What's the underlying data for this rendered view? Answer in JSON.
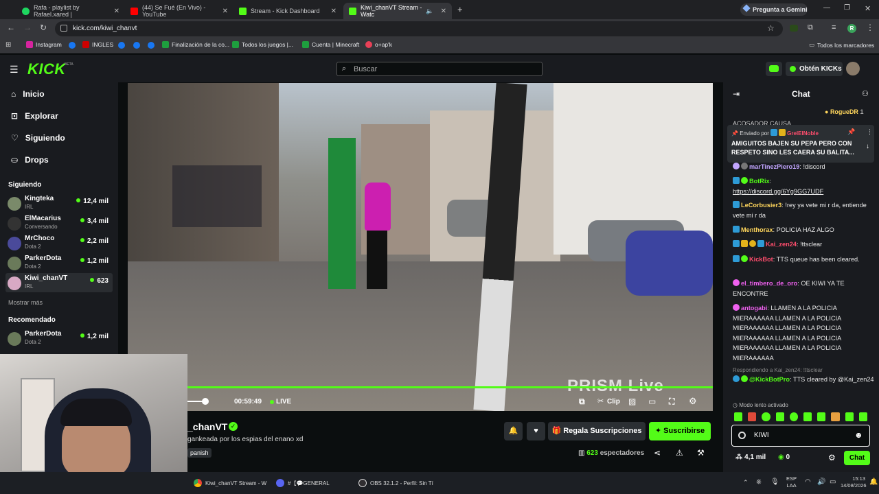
{
  "browser": {
    "tabs": [
      {
        "title": "Rafa - playlist by Rafael.xared |",
        "color": "#1ed760"
      },
      {
        "title": "(44) Se Fué (En Vivo) - YouTube",
        "color": "#ff0000"
      },
      {
        "title": "Stream - Kick Dashboard",
        "color": "#53fc18"
      },
      {
        "title": "Kiwi_chanVT Stream - Watc",
        "color": "#53fc18"
      }
    ],
    "gemini_label": "Pregunta a Gemini",
    "url": "kick.com/kiwi_chanvt",
    "profile_initial": "R",
    "bookmarks": [
      "Instagram",
      "INGLES",
      "Finalización de la co...",
      "Todos los juegos |...",
      "Cuenta | Minecraft",
      "o+ap'k"
    ],
    "all_bookmarks": "Todos los marcadores"
  },
  "header": {
    "logo": "KICK",
    "logo_badge": "BETA",
    "search_placeholder": "Buscar",
    "get_kicks": "Obtén KICKs"
  },
  "sidebar": {
    "nav": [
      {
        "label": "Inicio",
        "icon": "home-icon"
      },
      {
        "label": "Explorar",
        "icon": "compass-icon"
      },
      {
        "label": "Siguiendo",
        "icon": "heart-icon"
      },
      {
        "label": "Drops",
        "icon": "gift-icon"
      }
    ],
    "following_title": "Siguiendo",
    "following": [
      {
        "name": "Kingteka",
        "category": "IRL",
        "viewers": "12,4 mil"
      },
      {
        "name": "ElMacarius",
        "category": "Conversando",
        "viewers": "3,4 mil"
      },
      {
        "name": "MrChoco",
        "category": "Dota 2",
        "viewers": "2,2 mil"
      },
      {
        "name": "ParkerDota",
        "category": "Dota 2",
        "viewers": "1,2 mil"
      },
      {
        "name": "Kiwi_chanVT",
        "category": "IRL",
        "viewers": "623"
      }
    ],
    "show_more": "Mostrar más",
    "recommended_title": "Recomendado",
    "recommended": [
      {
        "name": "ParkerDota",
        "category": "Dota 2",
        "viewers": "1,2 mil"
      }
    ]
  },
  "player": {
    "time": "00:59:49",
    "live": "LIVE",
    "clip": "Clip",
    "watermark": "PRISM Live",
    "progress": 1.0
  },
  "stream": {
    "channel": "_chanVT",
    "title": "gankeada por los espias del enano xd",
    "language": "panish",
    "gift_subs": "Regala Suscripciones",
    "subscribe": "Suscribirse",
    "viewers": "623",
    "viewers_label": "espectadores"
  },
  "chat": {
    "title": "Chat",
    "top_gifter": "RogueDR",
    "top_gifter_count": "1",
    "cut_text": "ACOSADOR CAUSA",
    "pinned_by_label": "Enviado por",
    "pinned_by": "GrelEINoble",
    "pinned_text": "AMIGUITOS BAJEN SU PEPA PERO CON RESPETO SINO LES CAERA SU BALITA...",
    "messages": [
      {
        "user": "marTinezPiero19",
        "color": "#c2a6ff",
        "text": "!discord"
      },
      {
        "user": "BotRix",
        "color": "#53fc18",
        "text": "https://discord.gg/6Yg9GG7UDF"
      },
      {
        "user": "LeCorbusier3",
        "color": "#ffd65c",
        "text": "!rey ya vete mi r da, entiende vete mi r da"
      },
      {
        "user": "Menthorax",
        "color": "#ffd65c",
        "text": "POLICIA HAZ ALGO"
      },
      {
        "user": "Kai_zen24",
        "color": "#ff4d6d",
        "text": "!ttsclear"
      },
      {
        "user": "KickBot",
        "color": "#ff4d6d",
        "text": "TTS queue has been cleared."
      },
      {
        "user": "el_timbero_de_oro",
        "color": "#f061f0",
        "text": "OE KIWI YA TE ENCONTRE"
      },
      {
        "user": "antogabi",
        "color": "#f061f0",
        "text": "LLAMEN A LA POLICIA MIERAAAAAA LLAMEN A LA POLICIA MIERAAAAAA LLAMEN A LA POLICIA MIERAAAAAA LLAMEN A LA POLICIA MIERAAAAAA LLAMEN A LA POLICIA MIERAAAAAA"
      },
      {
        "reply": "Respondiendo a Kai_zen24: !ttsclear",
        "user": "@KickBotPro",
        "color": "#53fc18",
        "text": "TTS cleared by @Kai_zen24"
      }
    ],
    "slow_mode": "Modo lento activado",
    "input_value": "KIWI",
    "kicks": "4,1 mil",
    "points": "0",
    "send": "Chat"
  },
  "taskbar": {
    "items": [
      "Kiwi_chanVT Stream - W",
      "#【💬GENERAL",
      "OBS 32.1.2 - Perfil: Sin Tí"
    ],
    "lang": "ESP",
    "lang2": "LAA",
    "time": "15:13",
    "date": "14/08/2026"
  }
}
